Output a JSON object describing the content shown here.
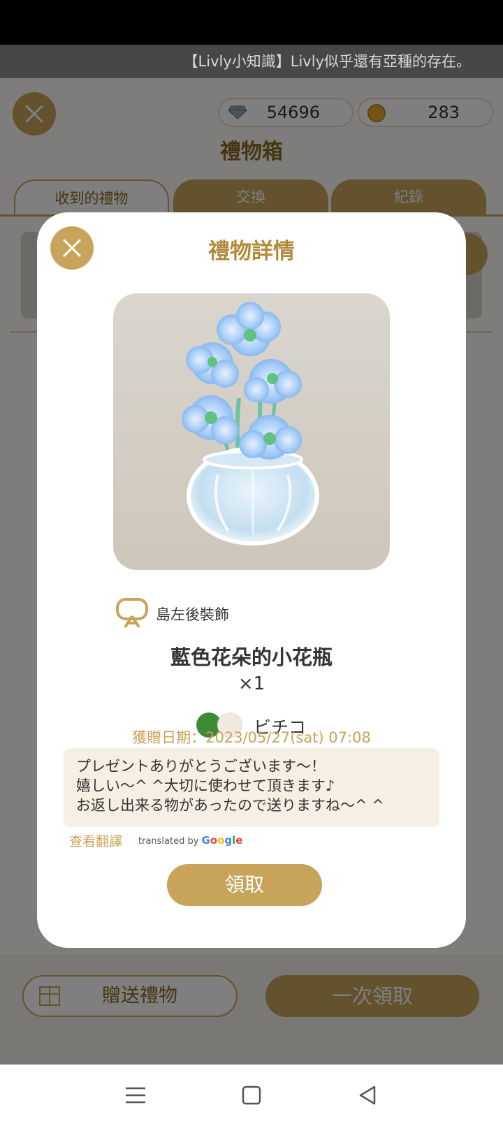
{
  "news_ticker": "【Livly小知識】Livly似乎還有亞種的存在。",
  "currencies": {
    "gems": "54696",
    "coins": "283"
  },
  "page_title": "禮物箱",
  "tabs": [
    "收到的禮物",
    "交換",
    "紀錄"
  ],
  "bottom_actions": {
    "send_gift": "贈送禮物",
    "claim_all": "一次領取"
  },
  "modal": {
    "title": "禮物詳情",
    "category": "島左後裝飾",
    "item_name": "藍色花朵的小花瓶",
    "quantity": "×1",
    "sender": "ビチコ",
    "date": "獲贈日期：2023/05/27(sat) 07:08",
    "message_lines": [
      "プレゼントありがとうございます〜！",
      "嬉しい〜^ ^大切に使わせて頂きます♪",
      "お返し出来る物があったので送りますね〜^ ^"
    ],
    "view_translation": "查看翻譯",
    "translated_by": "translated by",
    "translated_by_brand": [
      "G",
      "o",
      "o",
      "g",
      "l",
      "e"
    ],
    "claim_button": "領取"
  },
  "colors": {
    "accent": "#c7a45a",
    "title_gold": "#b28a3a",
    "text_dark": "#333333"
  },
  "icons": [
    "close-icon",
    "gem-icon",
    "coin-icon",
    "gift-icon",
    "island-decor-icon",
    "menu-icon",
    "home-icon",
    "back-icon"
  ]
}
